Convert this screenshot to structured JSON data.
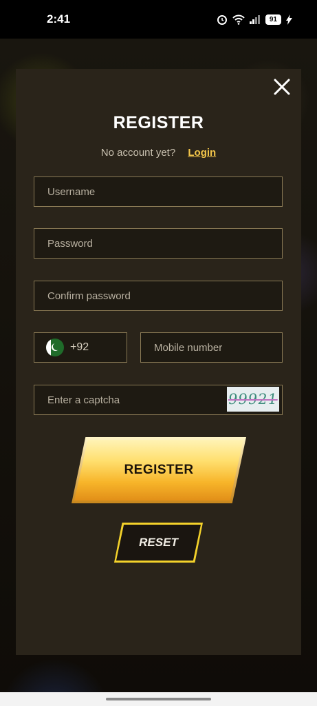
{
  "status_bar": {
    "time": "2:41",
    "battery": "91",
    "icons": [
      "alarm-icon",
      "wifi-icon",
      "signal-icon",
      "battery-icon",
      "charging-icon"
    ]
  },
  "modal": {
    "title": "REGISTER",
    "login_prompt": "No account yet?",
    "login_link": "Login",
    "username_placeholder": "Username",
    "password_placeholder": "Password",
    "confirm_placeholder": "Confirm password",
    "country_code": "+92",
    "country_flag": "pakistan-flag-icon",
    "mobile_placeholder": "Mobile number",
    "captcha_placeholder": "Enter a captcha",
    "captcha_code": "99921",
    "register_label": "REGISTER",
    "reset_label": "RESET"
  },
  "colors": {
    "accent": "#f3c64a",
    "modal_bg": "#2a241a",
    "field_border": "#8a7a55"
  }
}
